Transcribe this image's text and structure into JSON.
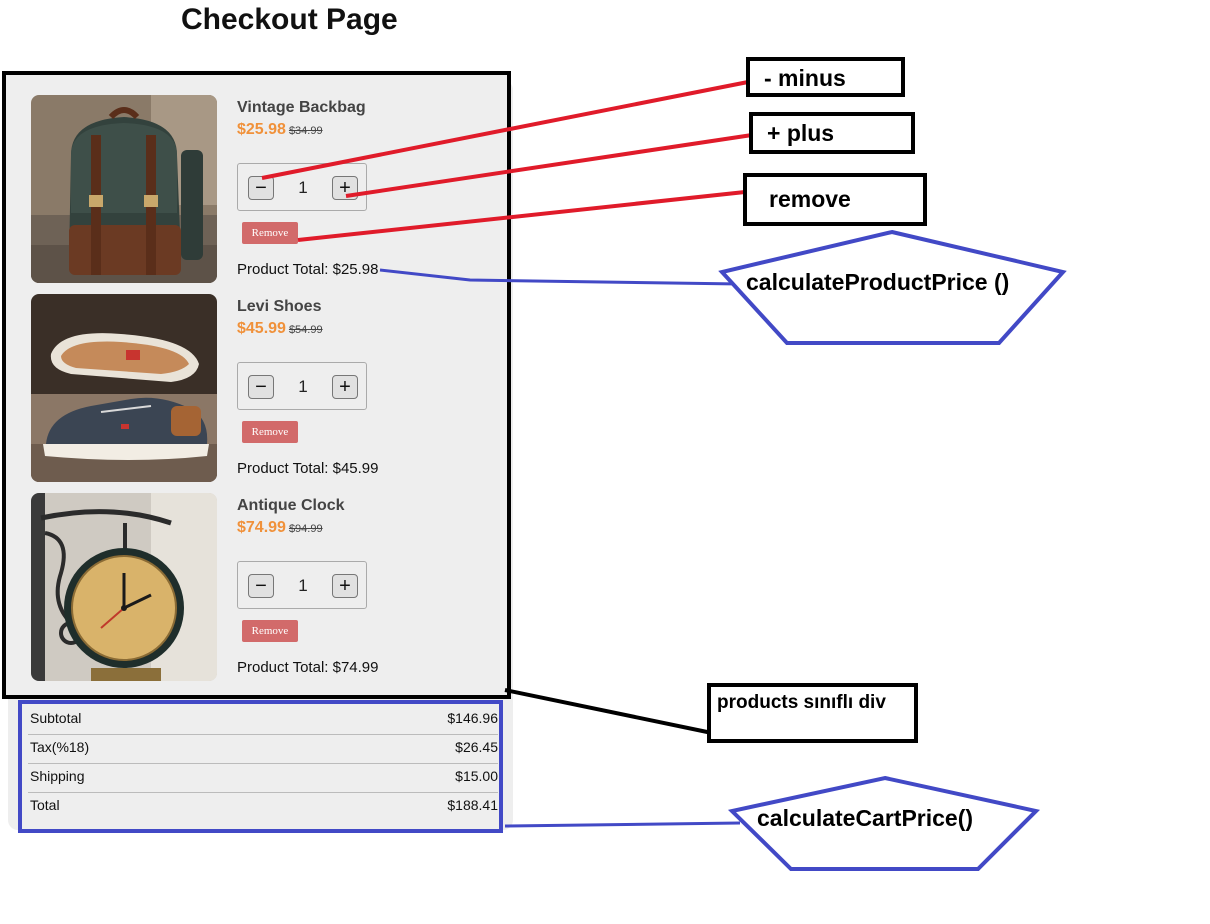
{
  "page": {
    "title": "Checkout Page"
  },
  "products": [
    {
      "name": "Vintage Backbag",
      "price": "$25.98",
      "old_price": "$34.99",
      "quantity": "1",
      "remove_label": "Remove",
      "total": "Product Total: $25.98",
      "image": "backpack"
    },
    {
      "name": "Levi Shoes",
      "price": "$45.99",
      "old_price": "$54.99",
      "quantity": "1",
      "remove_label": "Remove",
      "total": "Product Total: $45.99",
      "image": "shoe"
    },
    {
      "name": "Antique Clock",
      "price": "$74.99",
      "old_price": "$94.99",
      "quantity": "1",
      "remove_label": "Remove",
      "total": "Product Total: $74.99",
      "image": "clock"
    }
  ],
  "controls": {
    "minus_symbol": "−",
    "plus_symbol": "+"
  },
  "summary": {
    "rows": [
      {
        "label": "Subtotal",
        "value": "$146.96"
      },
      {
        "label": "Tax(%18)",
        "value": "$26.45"
      },
      {
        "label": "Shipping",
        "value": "$15.00"
      },
      {
        "label": "Total",
        "value": "$188.41"
      }
    ]
  },
  "annotations": {
    "minus": "- minus",
    "plus": "+ plus",
    "remove": "remove",
    "calc_product": "calculateProductPrice ()",
    "products_div": "products sınıflı div",
    "calc_cart": "calculateCartPrice()"
  },
  "colors": {
    "accent_price": "#f0913a",
    "remove_button": "#d26a6a",
    "annotation_red": "#e01b2a",
    "annotation_blue": "#4249c6"
  }
}
